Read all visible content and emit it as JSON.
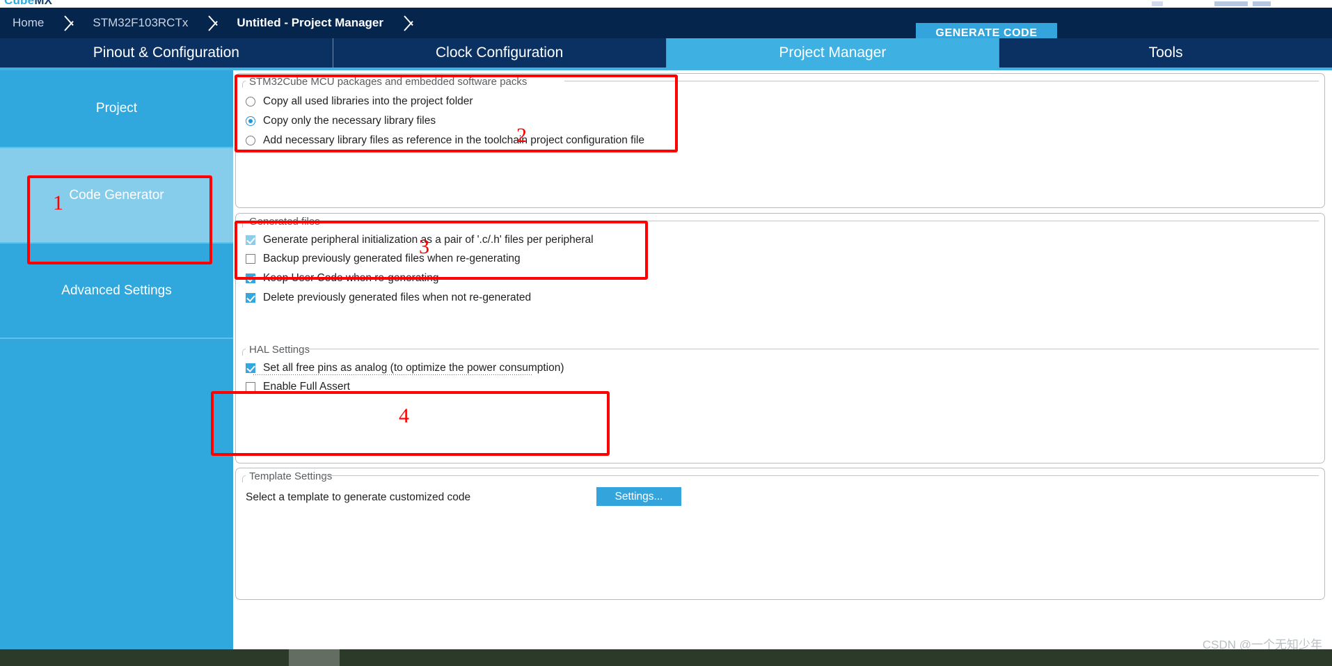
{
  "app": {
    "logo_primary": "Cube",
    "logo_secondary": "MX"
  },
  "breadcrumb": {
    "items": [
      {
        "label": "Home",
        "active": false
      },
      {
        "label": "STM32F103RCTx",
        "active": false
      },
      {
        "label": "Untitled - Project Manager",
        "active": true
      }
    ],
    "generate_code_label": "GENERATE CODE"
  },
  "tabs": [
    {
      "label": "Pinout & Configuration",
      "selected": false
    },
    {
      "label": "Clock Configuration",
      "selected": false
    },
    {
      "label": "Project Manager",
      "selected": true
    },
    {
      "label": "Tools",
      "selected": false
    }
  ],
  "sidebar": {
    "items": [
      {
        "label": "Project",
        "selected": false
      },
      {
        "label": "Code Generator",
        "selected": true
      },
      {
        "label": "Advanced Settings",
        "selected": false
      },
      {
        "label": "",
        "selected": false
      }
    ]
  },
  "groups": {
    "packages": {
      "title": "STM32Cube MCU packages and embedded software packs",
      "options": [
        {
          "label": "Copy all used libraries into the project folder",
          "checked": false
        },
        {
          "label": "Copy only the necessary library files",
          "checked": true
        },
        {
          "label": "Add necessary library files as reference in the toolchain project configuration file",
          "checked": false
        }
      ]
    },
    "generated_files": {
      "title": "Generated files",
      "options": [
        {
          "label": "Generate peripheral initialization as a pair of '.c/.h' files per peripheral",
          "checked": true
        },
        {
          "label": "Backup previously generated files when re-generating",
          "checked": false
        },
        {
          "label": "Keep User Code when re-generating",
          "checked": true
        },
        {
          "label": "Delete previously generated files when not re-generated",
          "checked": true
        }
      ]
    },
    "hal_settings": {
      "title": "HAL Settings",
      "options": [
        {
          "label": "Set all free pins as analog (to optimize the power consumption)",
          "checked": true
        },
        {
          "label": "Enable Full Assert",
          "checked": false
        }
      ]
    },
    "template_settings": {
      "title": "Template Settings",
      "description": "Select a template to generate customized code",
      "settings_button": "Settings..."
    }
  },
  "annotations": [
    {
      "number": "1",
      "target": "sidebar-code-generator"
    },
    {
      "number": "2",
      "target": "packages-group"
    },
    {
      "number": "3",
      "target": "generated-files-first-option"
    },
    {
      "number": "4",
      "target": "hal-settings-first-option"
    }
  ],
  "watermark": "CSDN @一个无知少年",
  "colors": {
    "accent": "#34a5dc",
    "navy": "#05254c",
    "tab_navy": "#0a3161",
    "tab_selected": "#3fb0e2",
    "sidebar": "#31a8dd",
    "sidebar_selected": "#86cdeb",
    "annotation_red": "#fe0000"
  }
}
